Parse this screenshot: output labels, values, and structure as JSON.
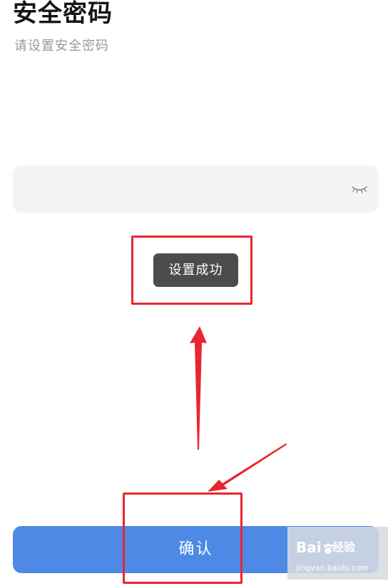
{
  "header": {
    "title": "安全密码",
    "subtitle": "请设置安全密码"
  },
  "password": {
    "value": "",
    "placeholder": "",
    "toggle_icon": "eye-closed-icon"
  },
  "toast": {
    "message": "设置成功"
  },
  "confirm": {
    "label": "确认"
  },
  "annotations": {
    "color": "#e8262f"
  },
  "watermark": {
    "brand_left": "Bai",
    "brand_right": "经验",
    "url": "jingyan.baidu.com"
  },
  "colors": {
    "button": "#4d89e5",
    "toast_bg": "#4c4c4c",
    "input_bg": "#f4f4f4"
  }
}
